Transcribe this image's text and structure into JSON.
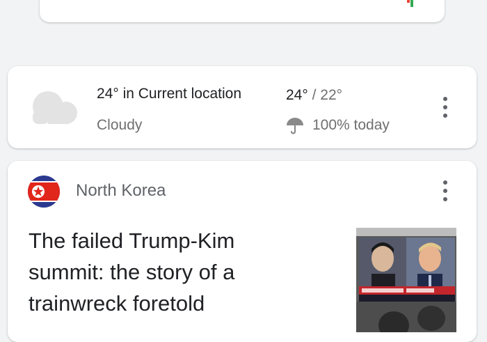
{
  "weather": {
    "location_text": "24° in Current location",
    "condition": "Cloudy",
    "high": "24°",
    "separator": "/",
    "low": "22°",
    "precipitation": "100% today",
    "icon": "cloud-icon"
  },
  "news": {
    "source": "North Korea",
    "title": "The failed Trump-Kim summit: the story of a trainwreck foretold",
    "flag_icon": "north-korea-flag-icon"
  },
  "colors": {
    "background": "#f1f3f4",
    "card": "#ffffff",
    "primary_text": "#202124",
    "secondary_text": "#6f6f6f",
    "flag_red": "#e1261c",
    "flag_blue": "#2b3990"
  }
}
